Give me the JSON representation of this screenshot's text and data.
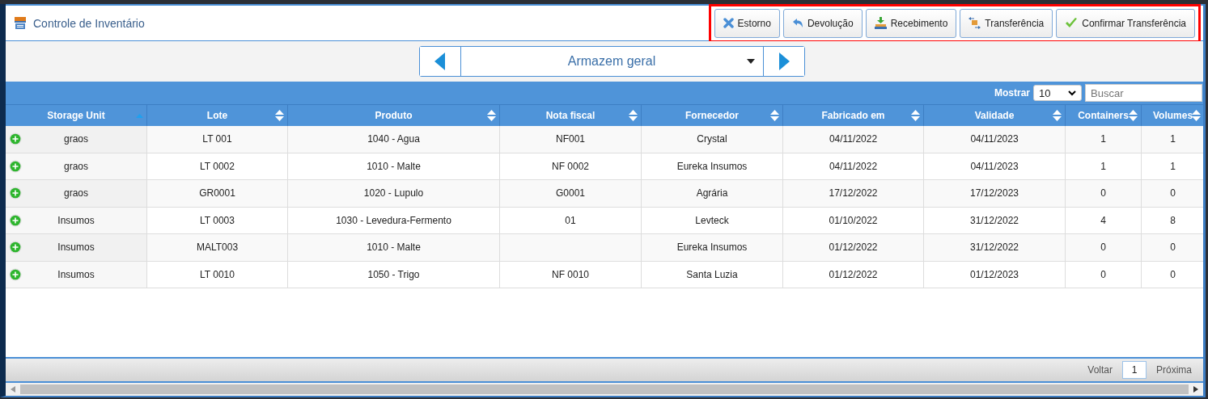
{
  "window": {
    "title": "Controle de Inventário"
  },
  "toolbar": {
    "highlighted": true,
    "buttons": [
      {
        "kind": "cancel",
        "label": "Estorno"
      },
      {
        "kind": "return",
        "label": "Devolução"
      },
      {
        "kind": "receive",
        "label": "Recebimento"
      },
      {
        "kind": "transfer",
        "label": "Transferência"
      },
      {
        "kind": "confirm",
        "label": "Confirmar Transferência"
      }
    ]
  },
  "warehouse_selector": {
    "value": "Armazem geral"
  },
  "table_controls": {
    "show_label": "Mostrar",
    "show_value": "10",
    "search_placeholder": "Buscar"
  },
  "table": {
    "columns": [
      {
        "label": "Storage Unit",
        "sorted": true
      },
      {
        "label": "Lote",
        "sorted": false
      },
      {
        "label": "Produto",
        "sorted": false
      },
      {
        "label": "Nota fiscal",
        "sorted": false
      },
      {
        "label": "Fornecedor",
        "sorted": false
      },
      {
        "label": "Fabricado em",
        "sorted": false
      },
      {
        "label": "Validade",
        "sorted": false
      },
      {
        "label": "Containers",
        "sorted": false
      },
      {
        "label": "Volumes",
        "sorted": false
      }
    ],
    "rows": [
      [
        "graos",
        "LT 001",
        "1040 - Agua",
        "NF001",
        "Crystal",
        "04/11/2022",
        "04/11/2023",
        "1",
        "1"
      ],
      [
        "graos",
        "LT 0002",
        "1010 - Malte",
        "NF 0002",
        "Eureka Insumos",
        "04/11/2022",
        "04/11/2023",
        "1",
        "1"
      ],
      [
        "graos",
        "GR0001",
        "1020 - Lupulo",
        "G0001",
        "Agrária",
        "17/12/2022",
        "17/12/2023",
        "0",
        "0"
      ],
      [
        "Insumos",
        "LT 0003",
        "1030 - Levedura-Fermento",
        "01",
        "Levteck",
        "01/10/2022",
        "31/12/2022",
        "4",
        "8"
      ],
      [
        "Insumos",
        "MALT003",
        "1010 - Malte",
        "",
        "Eureka Insumos",
        "01/12/2022",
        "31/12/2022",
        "0",
        "0"
      ],
      [
        "Insumos",
        "LT 0010",
        "1050 - Trigo",
        "NF 0010",
        "Santa Luzia",
        "01/12/2022",
        "01/12/2023",
        "0",
        "0"
      ]
    ]
  },
  "pagination": {
    "previous": "Voltar",
    "page": "1",
    "next": "Próxima"
  }
}
